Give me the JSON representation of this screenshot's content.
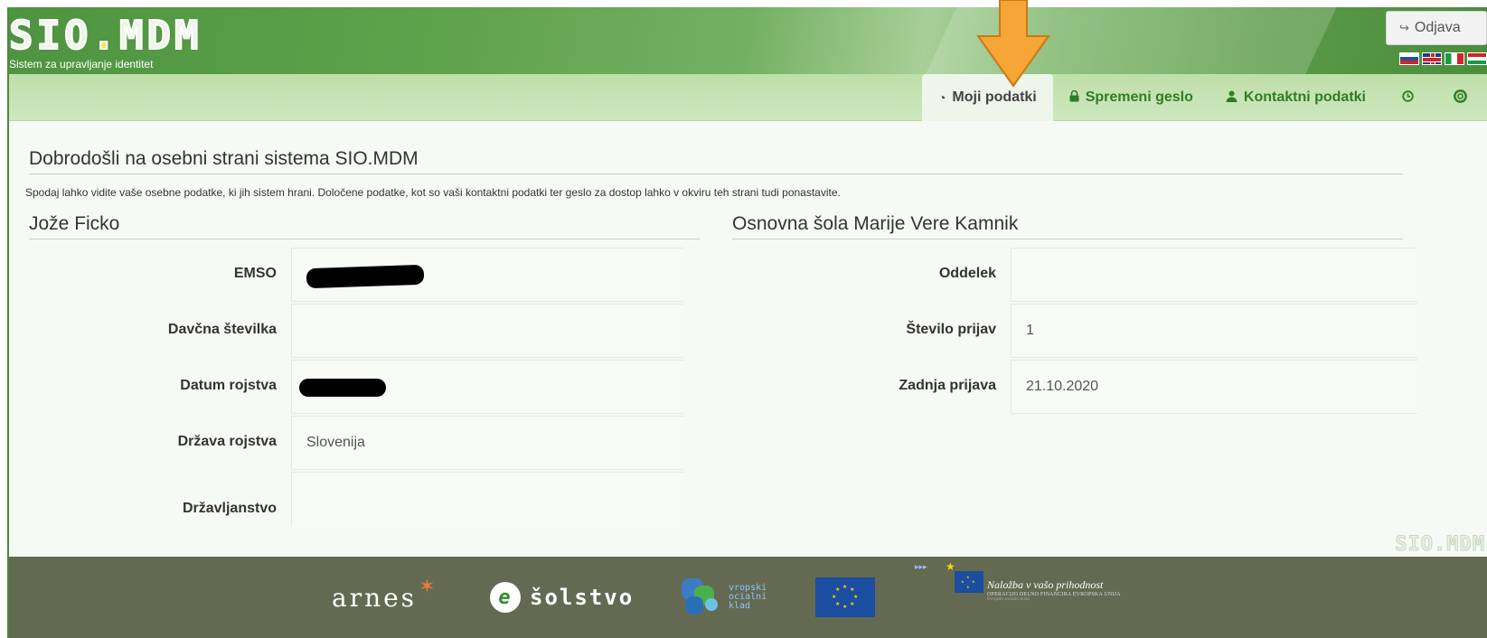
{
  "header": {
    "logo_text_a": "SIO",
    "logo_text_dot": ".",
    "logo_text_b": "MDM",
    "subtitle": "Sistem za upravljanje identitet",
    "logout_label": "Odjava",
    "logout_icon": "sign-out-icon",
    "flags": [
      "si",
      "uk",
      "it",
      "hu"
    ]
  },
  "nav": {
    "items": [
      {
        "label": "Moji podatki",
        "icon": "dashboard-icon",
        "active": true
      },
      {
        "label": "Spremeni geslo",
        "icon": "lock-icon",
        "active": false
      },
      {
        "label": "Kontaktni podatki",
        "icon": "user-icon",
        "active": false
      },
      {
        "label": "",
        "icon": "clock-icon",
        "active": false
      },
      {
        "label": "",
        "icon": "lifebuoy-icon",
        "active": false
      }
    ]
  },
  "main": {
    "welcome_title": "Dobrodošli na osebni strani sistema SIO.MDM",
    "intro": "Spodaj lahko vidite vaše osebne podatke, ki jih sistem hrani. Določene podatke, kot so vaši kontaktni podatki ter geslo za dostop lahko v okviru teh strani tudi ponastavite.",
    "person_name": "Jože Ficko",
    "school_name": "Osnovna šola Marije Vere Kamnik",
    "left_fields": [
      {
        "label": "EMSO",
        "value": "",
        "redacted": true
      },
      {
        "label": "Davčna številka",
        "value": ""
      },
      {
        "label": "Datum rojstva",
        "value": "",
        "redacted": true
      },
      {
        "label": "Država rojstva",
        "value": "Slovenija"
      },
      {
        "label": "Državljanstvo",
        "value": ""
      }
    ],
    "right_fields": [
      {
        "label": "Oddelek",
        "value": ""
      },
      {
        "label": "Število prijav",
        "value": "1"
      },
      {
        "label": "Zadnja prijava",
        "value": "21.10.2020"
      }
    ],
    "watermark": "SIO.MDM"
  },
  "footer": {
    "arnes": "arnes",
    "solstvo": "šolstvo",
    "e_letter": "e",
    "esf_text": [
      "vropski",
      "ocialni",
      "klad"
    ],
    "eu_slogan": "Naložba v vašo prihodnost",
    "eu_sub": "OPERACIJO DELNO FINANCIRA EVROPSKA UNIJA",
    "eu_sub2": "Evropski socialni sklad"
  },
  "colors": {
    "header_green": "#5fa24c",
    "nav_green": "#2e7d26",
    "footer_bg": "#646a52",
    "arrow": "#f6a536"
  }
}
